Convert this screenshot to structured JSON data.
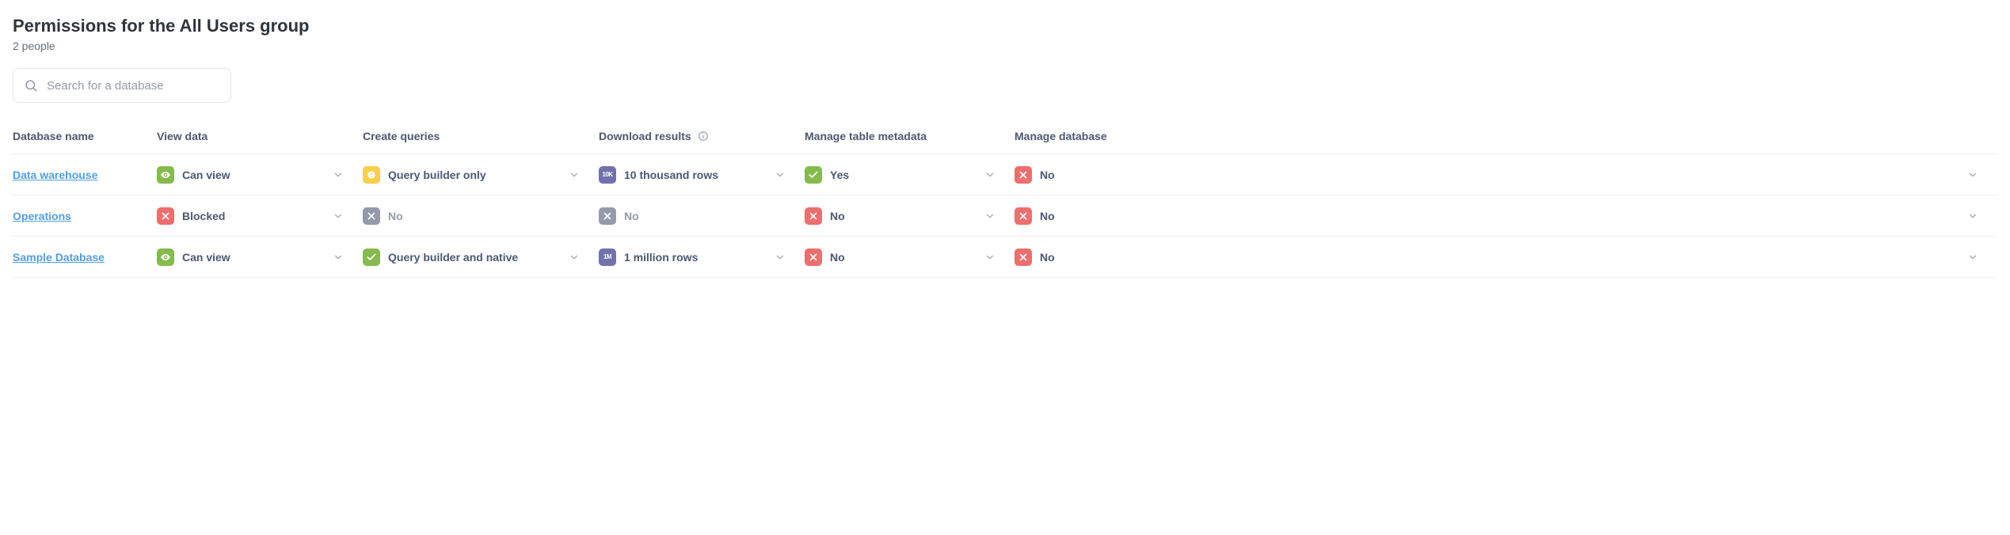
{
  "header": {
    "title": "Permissions for the All Users group",
    "subtitle": "2 people"
  },
  "search": {
    "placeholder": "Search for a database"
  },
  "columns": {
    "name": "Database name",
    "view": "View data",
    "create": "Create queries",
    "download": "Download results",
    "metadata": "Manage table metadata",
    "manage": "Manage database"
  },
  "rows": [
    {
      "name": "Data warehouse",
      "view": {
        "icon": "eye",
        "color": "green",
        "label": "Can view",
        "dropdown": true,
        "disabled": false
      },
      "create": {
        "icon": "qb",
        "color": "yellow",
        "label": "Query builder only",
        "dropdown": true,
        "disabled": false
      },
      "download": {
        "icon": "10k",
        "color": "purple",
        "label": "10 thousand rows",
        "dropdown": true,
        "disabled": false
      },
      "metadata": {
        "icon": "check",
        "color": "green",
        "label": "Yes",
        "dropdown": true,
        "disabled": false
      },
      "manage": {
        "icon": "x",
        "color": "red",
        "label": "No",
        "dropdown": true,
        "disabled": false
      }
    },
    {
      "name": "Operations",
      "view": {
        "icon": "x",
        "color": "red",
        "label": "Blocked",
        "dropdown": true,
        "disabled": false
      },
      "create": {
        "icon": "x",
        "color": "gray",
        "label": "No",
        "dropdown": false,
        "disabled": true
      },
      "download": {
        "icon": "x",
        "color": "gray",
        "label": "No",
        "dropdown": false,
        "disabled": true
      },
      "metadata": {
        "icon": "x",
        "color": "red",
        "label": "No",
        "dropdown": true,
        "disabled": false
      },
      "manage": {
        "icon": "x",
        "color": "red",
        "label": "No",
        "dropdown": true,
        "disabled": false
      }
    },
    {
      "name": "Sample Database",
      "view": {
        "icon": "eye",
        "color": "green",
        "label": "Can view",
        "dropdown": true,
        "disabled": false
      },
      "create": {
        "icon": "check",
        "color": "green",
        "label": "Query builder and native",
        "dropdown": true,
        "disabled": false
      },
      "download": {
        "icon": "1m",
        "color": "purple",
        "label": "1 million rows",
        "dropdown": true,
        "disabled": false
      },
      "metadata": {
        "icon": "x",
        "color": "red",
        "label": "No",
        "dropdown": true,
        "disabled": false
      },
      "manage": {
        "icon": "x",
        "color": "red",
        "label": "No",
        "dropdown": true,
        "disabled": false
      }
    }
  ]
}
